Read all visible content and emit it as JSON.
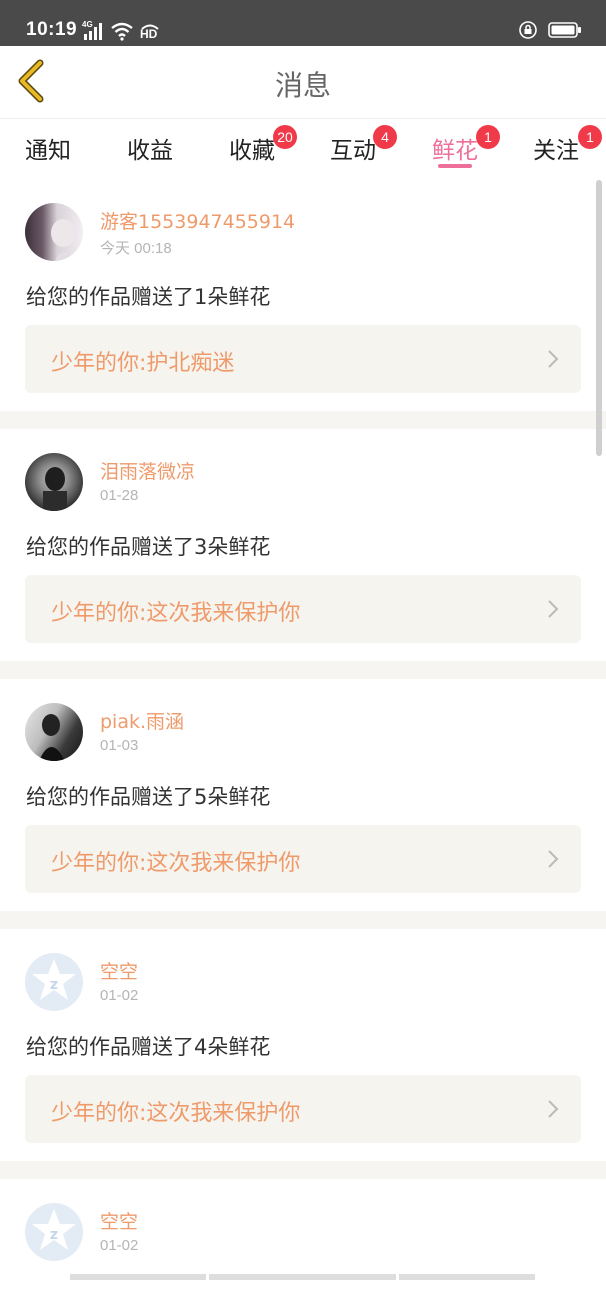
{
  "status_bar": {
    "time": "10:19",
    "network_label": "4G",
    "hd_label": "HD"
  },
  "header": {
    "title": "消息"
  },
  "tabs": [
    {
      "label": "通知",
      "badge": ""
    },
    {
      "label": "收益",
      "badge": ""
    },
    {
      "label": "收藏",
      "badge": "20"
    },
    {
      "label": "互动",
      "badge": "4"
    },
    {
      "label": "鲜花",
      "badge": "1",
      "active": true
    },
    {
      "label": "关注",
      "badge": "1"
    }
  ],
  "messages": [
    {
      "username": "游客1553947455914",
      "time": "今天 00:18",
      "text": "给您的作品赠送了1朵鲜花",
      "work": "少年的你:护北痴迷"
    },
    {
      "username": "泪雨落微凉",
      "time": "01-28",
      "text": "给您的作品赠送了3朵鲜花",
      "work": "少年的你:这次我来保护你"
    },
    {
      "username": "piak.雨涵",
      "time": "01-03",
      "text": "给您的作品赠送了5朵鲜花",
      "work": "少年的你:这次我来保护你"
    },
    {
      "username": "空空",
      "time": "01-02",
      "text": "给您的作品赠送了4朵鲜花",
      "work": "少年的你:这次我来保护你"
    },
    {
      "username": "空空",
      "time": "01-02",
      "text": "",
      "work": ""
    }
  ],
  "colors": {
    "accent": "#ee6f9a",
    "username": "#ef9a6b",
    "badge": "#f03a4a",
    "back_arrow": "#e8b827"
  }
}
